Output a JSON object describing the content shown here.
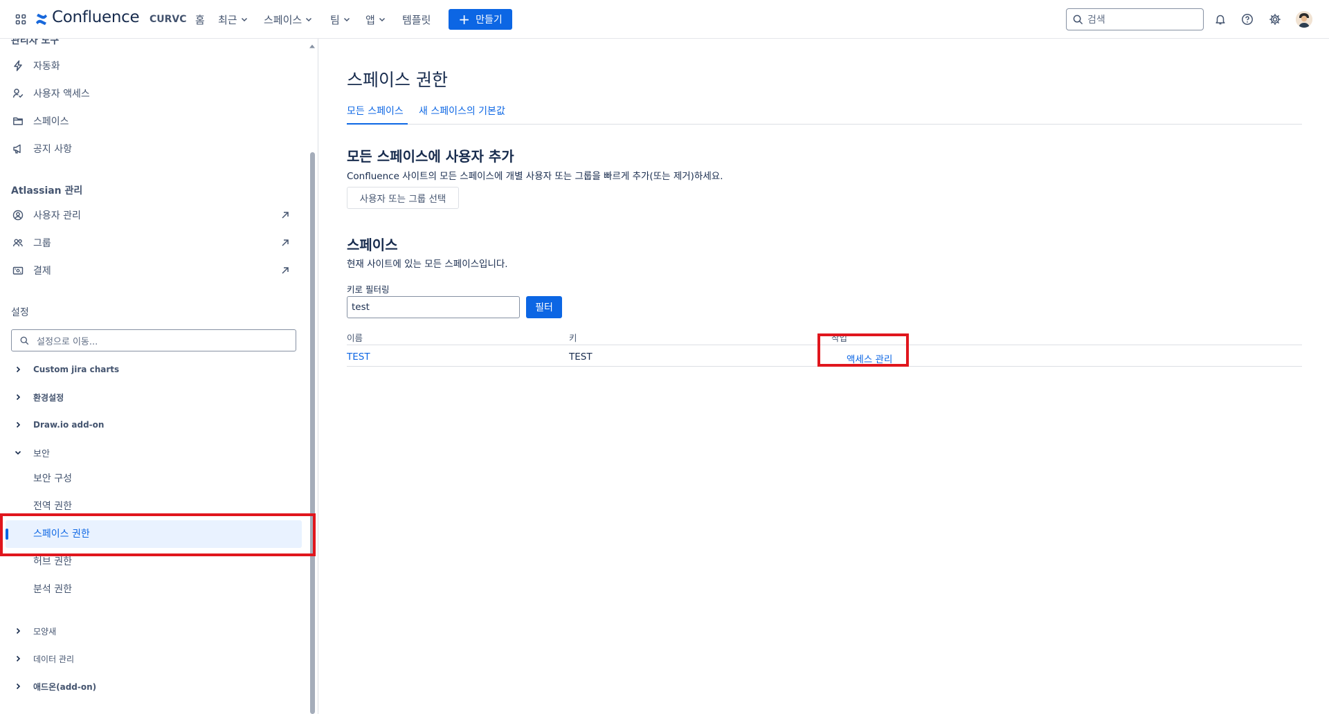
{
  "topnav": {
    "brand": "Confluence",
    "site_name": "CURVC",
    "items": [
      {
        "label": "홈"
      },
      {
        "label": "최근"
      },
      {
        "label": "스페이스"
      },
      {
        "label": "팀"
      },
      {
        "label": "앱"
      },
      {
        "label": "템플릿"
      }
    ],
    "create_label": "만들기",
    "search_placeholder": "검색",
    "icons": [
      "app-switcher-icon",
      "confluence-logo-icon",
      "bell-icon",
      "help-icon",
      "settings-icon",
      "avatar"
    ],
    "accent_color": "#0c66e4"
  },
  "sidebar": {
    "truncated_section": "관리자 도구",
    "admin_items": [
      {
        "label": "자동화",
        "icon": "lightning-icon"
      },
      {
        "label": "사용자 액세스",
        "icon": "user-access-icon"
      },
      {
        "label": "스페이스",
        "icon": "folder-icon"
      },
      {
        "label": "공지 사항",
        "icon": "megaphone-icon"
      }
    ],
    "atlassian_section": "Atlassian 관리",
    "atlassian_items": [
      {
        "label": "사용자 관리",
        "icon": "user-circle-icon"
      },
      {
        "label": "그룹",
        "icon": "people-icon"
      },
      {
        "label": "결제",
        "icon": "billing-icon"
      }
    ],
    "settings_section": "설정",
    "settings_search_placeholder": "설정으로 이동...",
    "tree_top": [
      {
        "label": "Custom jira charts"
      },
      {
        "label": "환경설정"
      },
      {
        "label": "Draw.io add-on"
      },
      {
        "label": "보안"
      }
    ],
    "security_sub": [
      {
        "label": "보안 구성"
      },
      {
        "label": "전역 권한"
      },
      {
        "label": "스페이스 권한"
      },
      {
        "label": "허브 권한"
      },
      {
        "label": "분석 권한"
      }
    ],
    "tree_bottom": [
      {
        "label": "모양새"
      },
      {
        "label": "데이터 관리"
      },
      {
        "label": "애드온(add-on)"
      }
    ]
  },
  "main": {
    "title": "스페이스 권한",
    "tabs": [
      {
        "label": "모든 스페이스"
      },
      {
        "label": "새 스페이스의 기본값"
      }
    ],
    "add_section": {
      "heading": "모든 스페이스에 사용자 추가",
      "description": "Confluence 사이트의 모든 스페이스에 개별 사용자 또는 그룹을 빠르게 추가(또는 제거)하세요.",
      "button": "사용자 또는 그룹 선택"
    },
    "spaces_section": {
      "heading": "스페이스",
      "description": "현재 사이트에 있는 모든 스페이스입니다.",
      "filter_label": "키로 필터링",
      "filter_value": "test",
      "filter_button": "필터",
      "columns": [
        "이름",
        "키",
        "작업"
      ],
      "rows": [
        {
          "name": "TEST",
          "key": "TEST",
          "action": "액세스 관리"
        }
      ]
    }
  }
}
